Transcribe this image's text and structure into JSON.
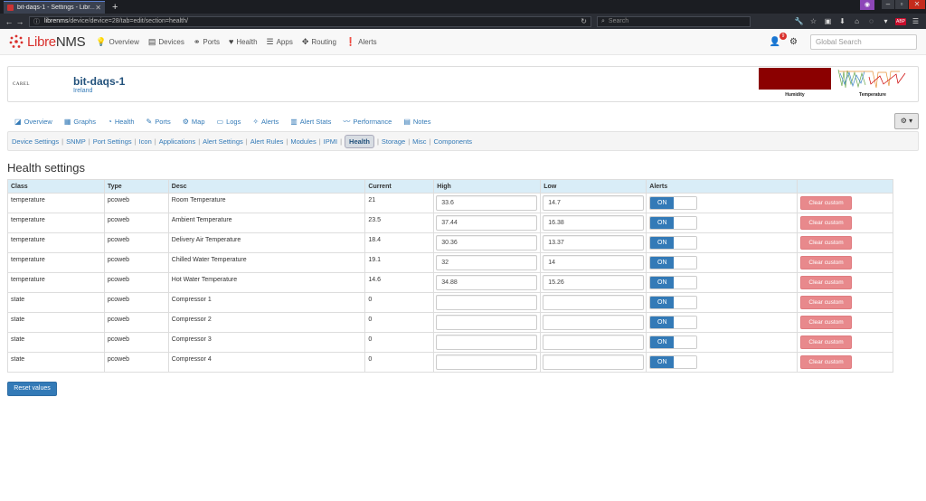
{
  "browser": {
    "tab_title": "bit-daqs-1 - Settings - Libr…",
    "url_host": "librenms",
    "url_path": "/device/device=28/tab=edit/section=health/",
    "search_placeholder": "Search"
  },
  "navbar": {
    "brand_libre": "Libre",
    "brand_nms": "NMS",
    "items": [
      {
        "label": "Overview",
        "icon": "lightbulb-icon",
        "glyph": "💡"
      },
      {
        "label": "Devices",
        "icon": "server-icon",
        "glyph": "▤"
      },
      {
        "label": "Ports",
        "icon": "link-icon",
        "glyph": "⚭"
      },
      {
        "label": "Health",
        "icon": "heartbeat-icon",
        "glyph": "♥"
      },
      {
        "label": "Apps",
        "icon": "tasks-icon",
        "glyph": "☰"
      },
      {
        "label": "Routing",
        "icon": "arrows-icon",
        "glyph": "✥"
      },
      {
        "label": "Alerts",
        "icon": "exclamation-circle-icon",
        "glyph": "❗"
      }
    ],
    "notification_count": "9",
    "global_search_placeholder": "Global Search"
  },
  "device": {
    "logo_text": "CAREL",
    "name": "bit-daqs-1",
    "location": "Ireland",
    "graph_labels": {
      "humidity": "Humidity",
      "temperature": "Temperature"
    }
  },
  "tabs": [
    {
      "label": "Overview",
      "icon": "overview-icon",
      "glyph": "◪"
    },
    {
      "label": "Graphs",
      "icon": "graphs-icon",
      "glyph": "▦"
    },
    {
      "label": "Health",
      "icon": "health-icon",
      "glyph": "◔"
    },
    {
      "label": "Ports",
      "icon": "ports-icon",
      "glyph": "✎"
    },
    {
      "label": "Map",
      "icon": "map-icon",
      "glyph": "⚙"
    },
    {
      "label": "Logs",
      "icon": "logs-icon",
      "glyph": "▭"
    },
    {
      "label": "Alerts",
      "icon": "alerts-icon",
      "glyph": "✧"
    },
    {
      "label": "Alert Stats",
      "icon": "alert-stats-icon",
      "glyph": "▥"
    },
    {
      "label": "Performance",
      "icon": "performance-icon",
      "glyph": "〰"
    },
    {
      "label": "Notes",
      "icon": "notes-icon",
      "glyph": "▤"
    }
  ],
  "subnav": [
    "Device Settings",
    "SNMP",
    "Port Settings",
    "Icon",
    "Applications",
    "Alert Settings",
    "Alert Rules",
    "Modules",
    "IPMI",
    "Health",
    "Storage",
    "Misc",
    "Components"
  ],
  "subnav_active": "Health",
  "page_title": "Health settings",
  "table": {
    "headers": [
      "Class",
      "Type",
      "Desc",
      "Current",
      "High",
      "Low",
      "Alerts",
      ""
    ],
    "rows": [
      {
        "class": "temperature",
        "type": "pcoweb",
        "desc": "Room Temperature",
        "current": "21",
        "high": "33.6",
        "low": "14.7"
      },
      {
        "class": "temperature",
        "type": "pcoweb",
        "desc": "Ambient Temperature",
        "current": "23.5",
        "high": "37.44",
        "low": "16.38"
      },
      {
        "class": "temperature",
        "type": "pcoweb",
        "desc": "Delivery Air Temperature",
        "current": "18.4",
        "high": "30.36",
        "low": "13.37"
      },
      {
        "class": "temperature",
        "type": "pcoweb",
        "desc": "Chilled Water Temperature",
        "current": "19.1",
        "high": "32",
        "low": "14"
      },
      {
        "class": "temperature",
        "type": "pcoweb",
        "desc": "Hot Water Temperature",
        "current": "14.6",
        "high": "34.88",
        "low": "15.26"
      },
      {
        "class": "state",
        "type": "pcoweb",
        "desc": "Compressor 1",
        "current": "0",
        "high": "",
        "low": ""
      },
      {
        "class": "state",
        "type": "pcoweb",
        "desc": "Compressor 2",
        "current": "0",
        "high": "",
        "low": ""
      },
      {
        "class": "state",
        "type": "pcoweb",
        "desc": "Compressor 3",
        "current": "0",
        "high": "",
        "low": ""
      },
      {
        "class": "state",
        "type": "pcoweb",
        "desc": "Compressor 4",
        "current": "0",
        "high": "",
        "low": ""
      }
    ],
    "alert_toggle_label": "ON",
    "clear_button_label": "Clear custom"
  },
  "reset_button_label": "Reset values",
  "colors": {
    "primary": "#337ab7",
    "danger_light": "#e8898c",
    "header_bg": "#d9edf7",
    "humidity_graph": "#8b0000"
  }
}
